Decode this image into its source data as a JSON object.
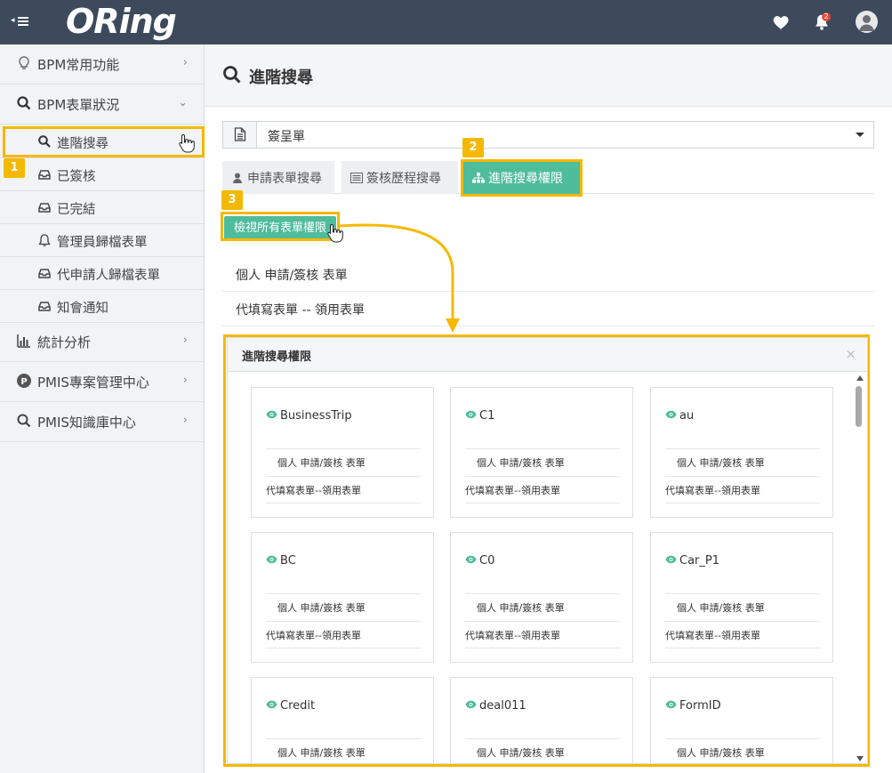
{
  "header": {
    "logo_text": "ORing",
    "notification_count": "2"
  },
  "sidebar": {
    "items": [
      {
        "label": "BPM常用功能",
        "icon": "lightbulb-icon"
      },
      {
        "label": "BPM表單狀況",
        "icon": "search-icon"
      },
      {
        "label": "統計分析",
        "icon": "bar-chart-icon"
      },
      {
        "label": "PMIS專案管理中心",
        "icon": "p-circle-icon"
      },
      {
        "label": "PMIS知識庫中心",
        "icon": "search-icon"
      }
    ],
    "sub_items": [
      {
        "label": "進階搜尋",
        "icon": "search-icon"
      },
      {
        "label": "已簽核",
        "icon": "inbox-icon"
      },
      {
        "label": "已完結",
        "icon": "inbox-icon"
      },
      {
        "label": "管理員歸檔表單",
        "icon": "bell-icon"
      },
      {
        "label": "代申請人歸檔表單",
        "icon": "inbox-icon"
      },
      {
        "label": "知會通知",
        "icon": "inbox-icon"
      }
    ]
  },
  "callouts": [
    "1",
    "2",
    "3"
  ],
  "main": {
    "title": "進階搜尋",
    "form_select": {
      "value": "簽呈單"
    },
    "tabs": [
      {
        "label": "申請表單搜尋",
        "icon": "user-icon"
      },
      {
        "label": "簽核歷程搜尋",
        "icon": "list-icon"
      },
      {
        "label": "進階搜尋權限",
        "icon": "sitemap-icon"
      }
    ],
    "view_button": "檢視所有表單權限",
    "list": [
      "個人 申請/簽核 表單",
      "代填寫表單 -- 領用表單"
    ]
  },
  "modal": {
    "title": "進階搜尋權限",
    "close": "×",
    "cards": [
      {
        "name": "BusinessTrip",
        "item1": "個人 申請/簽核 表單",
        "item2": "代填寫表單--領用表單"
      },
      {
        "name": "C1",
        "item1": "個人 申請/簽核 表單",
        "item2": "代填寫表單--領用表單"
      },
      {
        "name": "au",
        "item1": "個人 申請/簽核 表單",
        "item2": "代填寫表單--領用表單"
      },
      {
        "name": "BC",
        "item1": "個人 申請/簽核 表單",
        "item2": "代填寫表單--領用表單"
      },
      {
        "name": "C0",
        "item1": "個人 申請/簽核 表單",
        "item2": "代填寫表單--領用表單"
      },
      {
        "name": "Car_P1",
        "item1": "個人 申請/簽核 表單",
        "item2": "代填寫表單--領用表單"
      },
      {
        "name": "Credit",
        "item1": "個人 申請/簽核 表單",
        "item2": ""
      },
      {
        "name": "deal011",
        "item1": "個人 申請/簽核 表單",
        "item2": ""
      },
      {
        "name": "FormID",
        "item1": "個人 申請/簽核 表單",
        "item2": ""
      }
    ]
  },
  "colors": {
    "accent": "#4fbc9b",
    "highlight": "#f5b800",
    "topbar": "#3c4a5c"
  }
}
